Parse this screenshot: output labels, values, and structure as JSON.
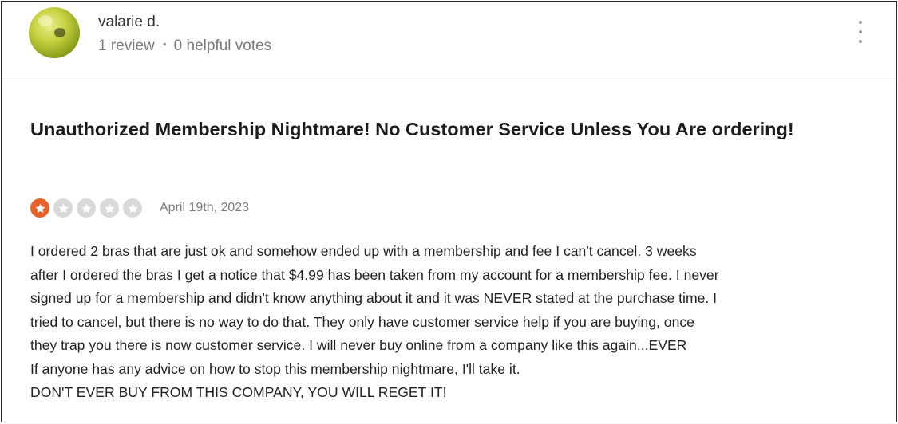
{
  "colors": {
    "star_filled": "#e8622b",
    "star_empty": "#d9d9d9",
    "meta_text": "#7a7a7a"
  },
  "reviewer": {
    "name": "valarie d.",
    "review_count": "1 review",
    "separator": "•",
    "helpful_votes": "0 helpful votes",
    "avatar_icon": "user-avatar-photo"
  },
  "menu": {
    "icon": "more-vertical-icon"
  },
  "review": {
    "title": "Unauthorized Membership Nightmare! No Customer Service Unless You Are ordering!",
    "rating": 1,
    "max_rating": 5,
    "date": "April 19th, 2023",
    "body_lines": [
      "I ordered 2 bras that are just ok and somehow ended up with a membership and fee I can't cancel. 3 weeks",
      "after I ordered the bras I get a notice that $4.99 has been taken from my account for a membership fee. I never",
      "signed up for a membership and didn't know anything about it and it was NEVER stated at the purchase time. I",
      "tried to cancel, but there is no way to do that. They only have customer service help if you are buying, once",
      "they trap you there is now customer service. I will never buy online from a company like this again...EVER",
      "If anyone has any advice on how to stop this membership nightmare, I'll take it.",
      "DON'T EVER BUY FROM THIS COMPANY, YOU WILL REGET IT!"
    ]
  }
}
